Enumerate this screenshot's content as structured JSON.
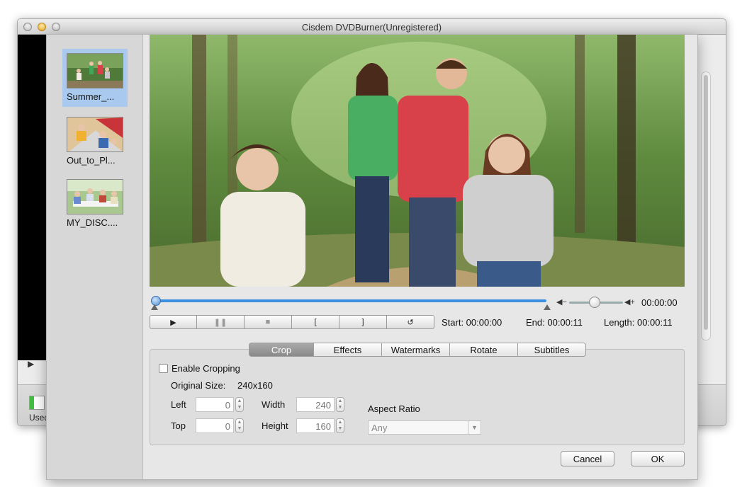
{
  "window": {
    "title": "Cisdem DVDBurner(Unregistered)"
  },
  "background": {
    "used_label": "Used",
    "play_icon": "▶"
  },
  "clips": [
    {
      "label": "Summer_...",
      "selected": true
    },
    {
      "label": "Out_to_Pl...",
      "selected": false
    },
    {
      "label": "MY_DISC....",
      "selected": false
    }
  ],
  "player": {
    "time": "00:00:00",
    "start_label": "Start: 00:00:00",
    "end_label": "End: 00:00:11",
    "length_label": "Length: 00:00:11",
    "volume_level": 0.48,
    "progress": 0.0,
    "controls": {
      "play": "▶",
      "pause": "❚❚",
      "stop": "■",
      "mark_in": "[",
      "mark_out": "]",
      "reset": "↺"
    }
  },
  "tabs": [
    {
      "label": "Crop",
      "active": true
    },
    {
      "label": "Effects",
      "active": false
    },
    {
      "label": "Watermarks",
      "active": false
    },
    {
      "label": "Rotate",
      "active": false
    },
    {
      "label": "Subtitles",
      "active": false
    }
  ],
  "crop": {
    "enable_label": "Enable Cropping",
    "enabled": false,
    "original_size_label": "Original Size:",
    "original_size_value": "240x160",
    "left_label": "Left",
    "left_value": "0",
    "top_label": "Top",
    "top_value": "0",
    "width_label": "Width",
    "width_value": "240",
    "height_label": "Height",
    "height_value": "160",
    "aspect_label": "Aspect Ratio",
    "aspect_value": "Any"
  },
  "buttons": {
    "cancel": "Cancel",
    "ok": "OK"
  }
}
